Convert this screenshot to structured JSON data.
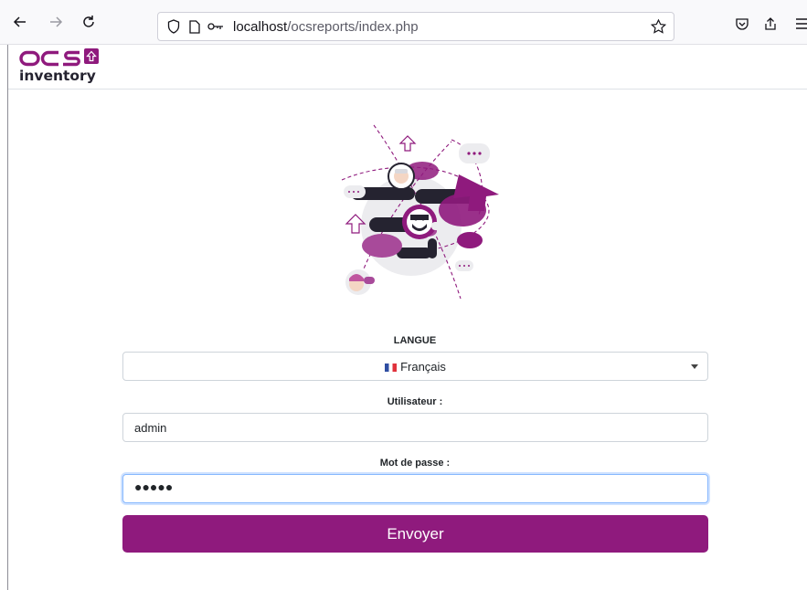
{
  "browser": {
    "url_host": "localhost",
    "url_path": "/ocsreports/index.php",
    "icons": {
      "back": "arrow-left-icon",
      "forward": "arrow-right-icon",
      "reload": "reload-icon",
      "shield": "shield-icon",
      "page": "page-icon",
      "key": "key-icon",
      "bookmark": "star-icon",
      "pocket": "pocket-icon",
      "share": "share-icon",
      "menu": "hamburger-menu-icon"
    }
  },
  "logo": {
    "text_top": "OCS",
    "text_bottom": "inventory"
  },
  "form": {
    "language_label": "LANGUE",
    "language_value": "Français",
    "user_label": "Utilisateur :",
    "user_value": "admin",
    "password_label": "Mot de passe :",
    "password_masked": "●●●●●",
    "submit_label": "Envoyer"
  },
  "colors": {
    "brand": "#8f1a7d",
    "brand_light": "#a84a9a",
    "dark": "#252330"
  }
}
